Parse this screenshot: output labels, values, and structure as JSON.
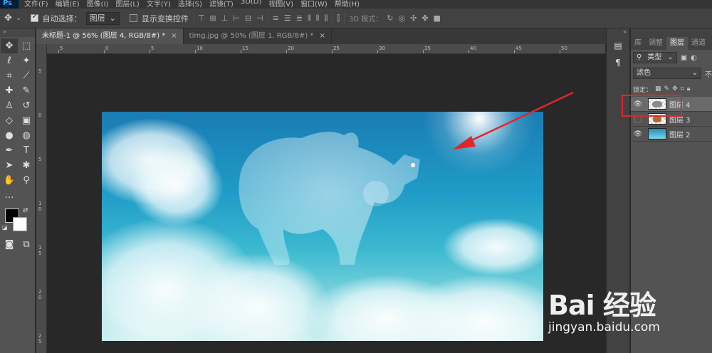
{
  "app": {
    "logo": "Ps"
  },
  "menu": [
    "文件(F)",
    "编辑(E)",
    "图像(I)",
    "图层(L)",
    "文字(Y)",
    "选择(S)",
    "滤镜(T)",
    "3D(D)",
    "视图(V)",
    "窗口(W)",
    "帮助(H)"
  ],
  "options": {
    "auto_select_label": "自动选择：",
    "auto_select_checked": true,
    "target_value": "图层",
    "show_transform_label": "显示变换控件",
    "mode_3d_label": "3D 模式："
  },
  "tabs": [
    {
      "label": "未标题-1 @ 56% (图层 4, RGB/8#) *",
      "active": true
    },
    {
      "label": "timg.jpg @ 50% (图层 1, RGB/8#) *",
      "active": false
    }
  ],
  "ruler_top": [
    "5",
    "0",
    "5",
    "10",
    "15",
    "20",
    "25",
    "30",
    "35",
    "40",
    "45",
    "50"
  ],
  "ruler_left": [
    "5",
    "0",
    "5",
    "1 0",
    "1 5",
    "2 0",
    "2 5"
  ],
  "panel": {
    "tabs": [
      "库",
      "调整",
      "图层",
      "通道"
    ],
    "active_tab": "图层",
    "filter_kind": "类型",
    "blend_mode": "滤色",
    "opacity_label": "不",
    "lock_label": "锁定："
  },
  "layers": [
    {
      "name": "图层 4",
      "visible": true,
      "selected": true,
      "thumb": "t4"
    },
    {
      "name": "图层 3",
      "visible": false,
      "selected": false,
      "thumb": "t3"
    },
    {
      "name": "图层 2",
      "visible": true,
      "selected": false,
      "thumb": "t2"
    }
  ],
  "watermark": {
    "brand": "Bai 经验",
    "url": "jingyan.baidu.com"
  },
  "colors": {
    "annotation_red": "#e0262b",
    "foreground": "#000000",
    "background": "#ffffff"
  }
}
